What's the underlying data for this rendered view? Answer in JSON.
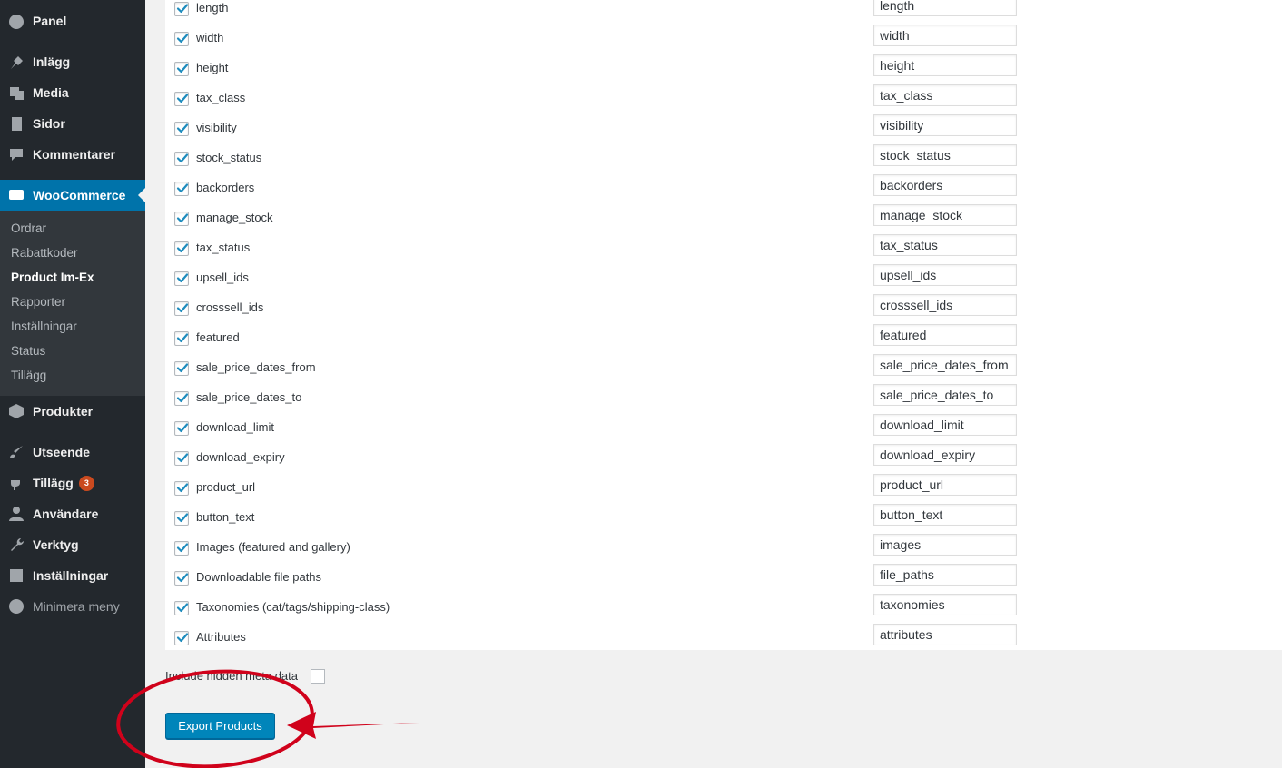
{
  "sidebar": {
    "items": [
      {
        "label": "Panel",
        "icon": "dashboard-icon"
      },
      {
        "label": "Inlägg",
        "icon": "pin-icon"
      },
      {
        "label": "Media",
        "icon": "media-icon"
      },
      {
        "label": "Sidor",
        "icon": "pages-icon"
      },
      {
        "label": "Kommentarer",
        "icon": "comment-icon"
      },
      {
        "label": "WooCommerce",
        "icon": "woo-icon"
      },
      {
        "label": "Produkter",
        "icon": "box-icon"
      },
      {
        "label": "Utseende",
        "icon": "brush-icon"
      },
      {
        "label": "Tillägg",
        "icon": "plugin-icon",
        "badge": "3"
      },
      {
        "label": "Användare",
        "icon": "user-icon"
      },
      {
        "label": "Verktyg",
        "icon": "wrench-icon"
      },
      {
        "label": "Inställningar",
        "icon": "settings-icon"
      },
      {
        "label": "Minimera meny",
        "icon": "collapse-icon"
      }
    ],
    "submenu": [
      "Ordrar",
      "Rabattkoder",
      "Product Im-Ex",
      "Rapporter",
      "Inställningar",
      "Status",
      "Tillägg"
    ],
    "colors": {
      "background": "#23282d",
      "active": "#0073aa",
      "submenu": "#32373c"
    }
  },
  "fields": [
    {
      "label": "length",
      "value": "length",
      "checked": true
    },
    {
      "label": "width",
      "value": "width",
      "checked": true
    },
    {
      "label": "height",
      "value": "height",
      "checked": true
    },
    {
      "label": "tax_class",
      "value": "tax_class",
      "checked": true
    },
    {
      "label": "visibility",
      "value": "visibility",
      "checked": true
    },
    {
      "label": "stock_status",
      "value": "stock_status",
      "checked": true
    },
    {
      "label": "backorders",
      "value": "backorders",
      "checked": true
    },
    {
      "label": "manage_stock",
      "value": "manage_stock",
      "checked": true
    },
    {
      "label": "tax_status",
      "value": "tax_status",
      "checked": true
    },
    {
      "label": "upsell_ids",
      "value": "upsell_ids",
      "checked": true
    },
    {
      "label": "crosssell_ids",
      "value": "crosssell_ids",
      "checked": true
    },
    {
      "label": "featured",
      "value": "featured",
      "checked": true
    },
    {
      "label": "sale_price_dates_from",
      "value": "sale_price_dates_from",
      "checked": true
    },
    {
      "label": "sale_price_dates_to",
      "value": "sale_price_dates_to",
      "checked": true
    },
    {
      "label": "download_limit",
      "value": "download_limit",
      "checked": true
    },
    {
      "label": "download_expiry",
      "value": "download_expiry",
      "checked": true
    },
    {
      "label": "product_url",
      "value": "product_url",
      "checked": true
    },
    {
      "label": "button_text",
      "value": "button_text",
      "checked": true
    },
    {
      "label": "Images (featured and gallery)",
      "value": "images",
      "checked": true
    },
    {
      "label": "Downloadable file paths",
      "value": "file_paths",
      "checked": true
    },
    {
      "label": "Taxonomies (cat/tags/shipping-class)",
      "value": "taxonomies",
      "checked": true
    },
    {
      "label": "Attributes",
      "value": "attributes",
      "checked": true
    }
  ],
  "meta": {
    "label": "Include hidden meta data",
    "checked": false
  },
  "export": {
    "label": "Export Products"
  },
  "accent": "#0085ba",
  "annotation_color": "#d0021b"
}
